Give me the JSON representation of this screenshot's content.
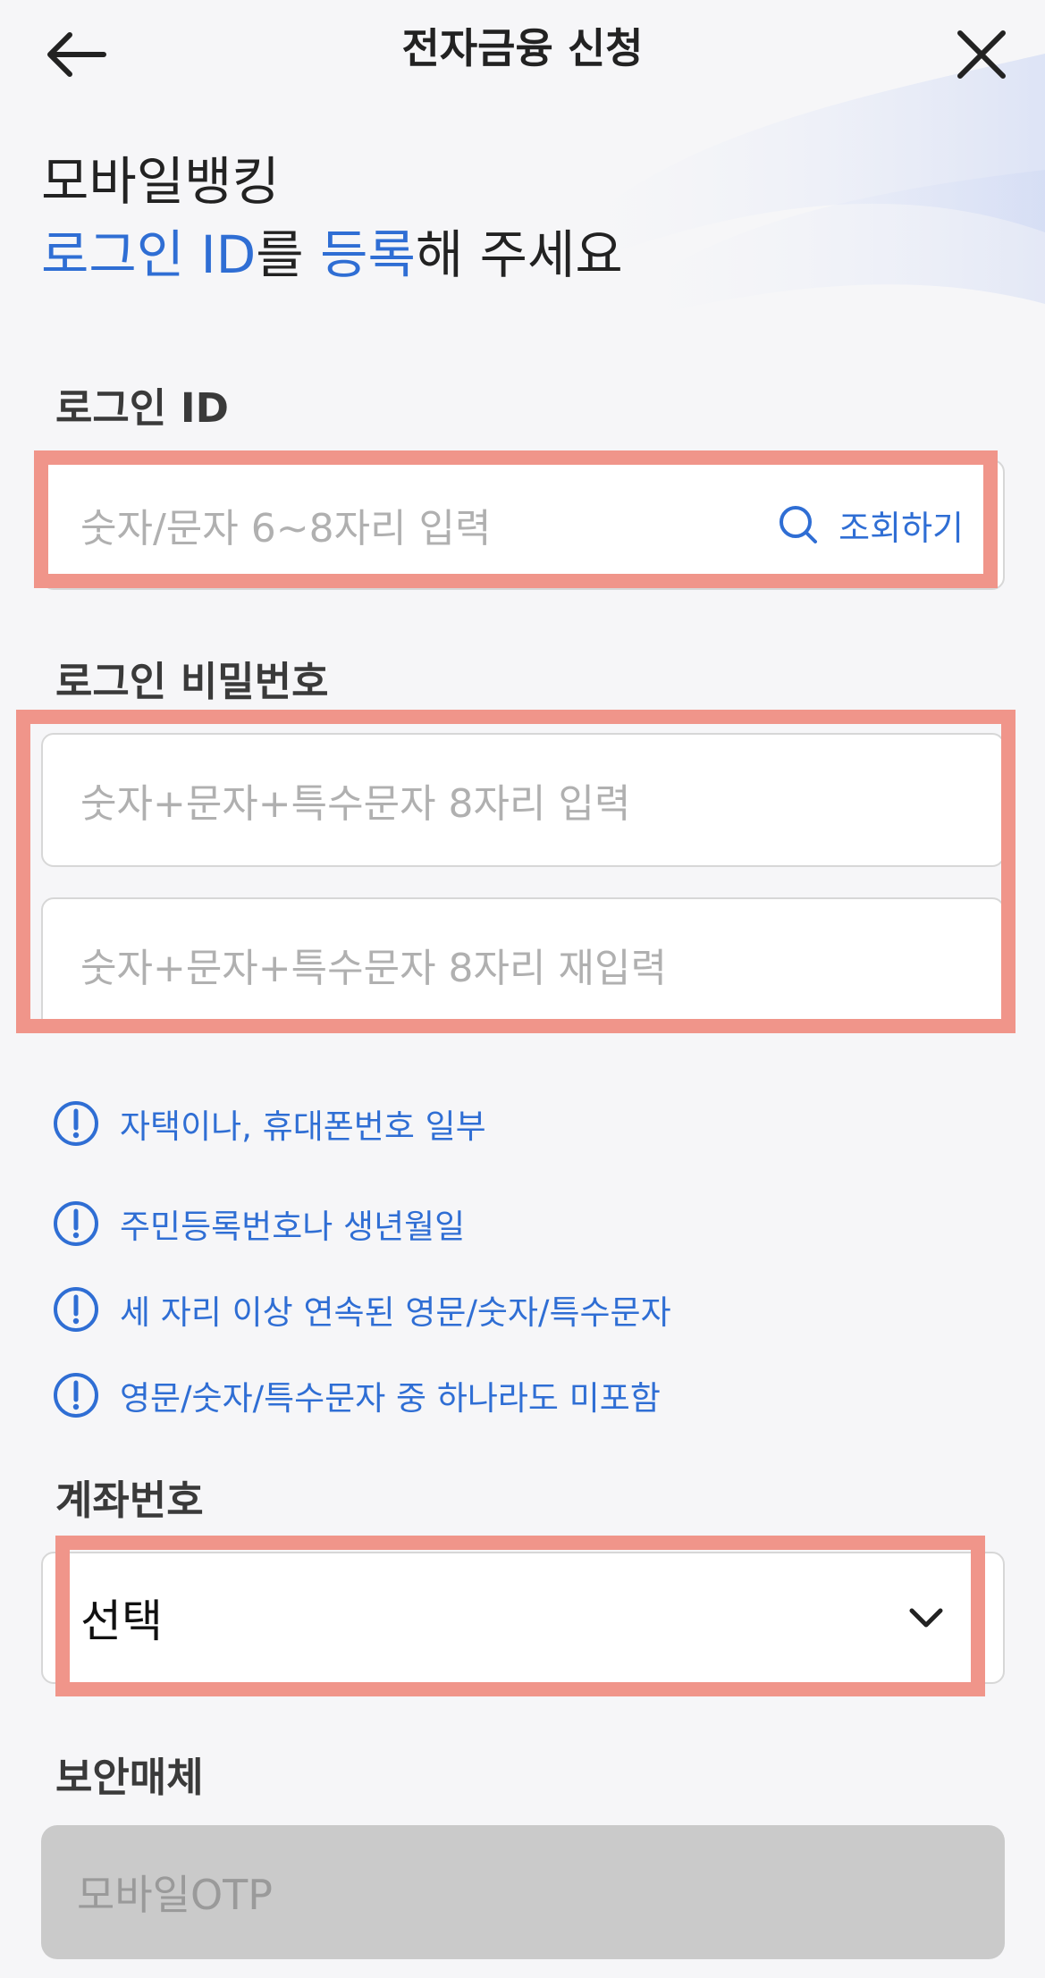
{
  "header": {
    "title": "전자금융 신청",
    "back_icon": "back-arrow-icon",
    "close_icon": "close-icon"
  },
  "headline": {
    "line1": "모바일뱅킹",
    "line2_part1": "로그인 ID",
    "line2_part2": "를 ",
    "line2_part3": "등록",
    "line2_part4": "해 주세요"
  },
  "login_id": {
    "label": "로그인 ID",
    "placeholder": "숫자/문자 6~8자리 입력",
    "search_label": "조회하기"
  },
  "password": {
    "label": "로그인 비밀번호",
    "placeholder": "숫자+문자+특수문자 8자리 입력",
    "confirm_placeholder": "숫자+문자+특수문자 8자리 재입력"
  },
  "rules": [
    "자택이나, 휴대폰번호 일부",
    "주민등록번호나 생년월일",
    "세 자리 이상 연속된 영문/숫자/특수문자",
    "영문/숫자/특수문자 중 하나라도 미포함"
  ],
  "account": {
    "label": "계좌번호",
    "selected": "선택"
  },
  "security": {
    "label": "보안매체",
    "value": "모바일OTP"
  },
  "colors": {
    "accent": "#2f6ed4",
    "highlight": "#f0958a",
    "background": "#f6f6f8",
    "disabled": "#cacaca"
  }
}
